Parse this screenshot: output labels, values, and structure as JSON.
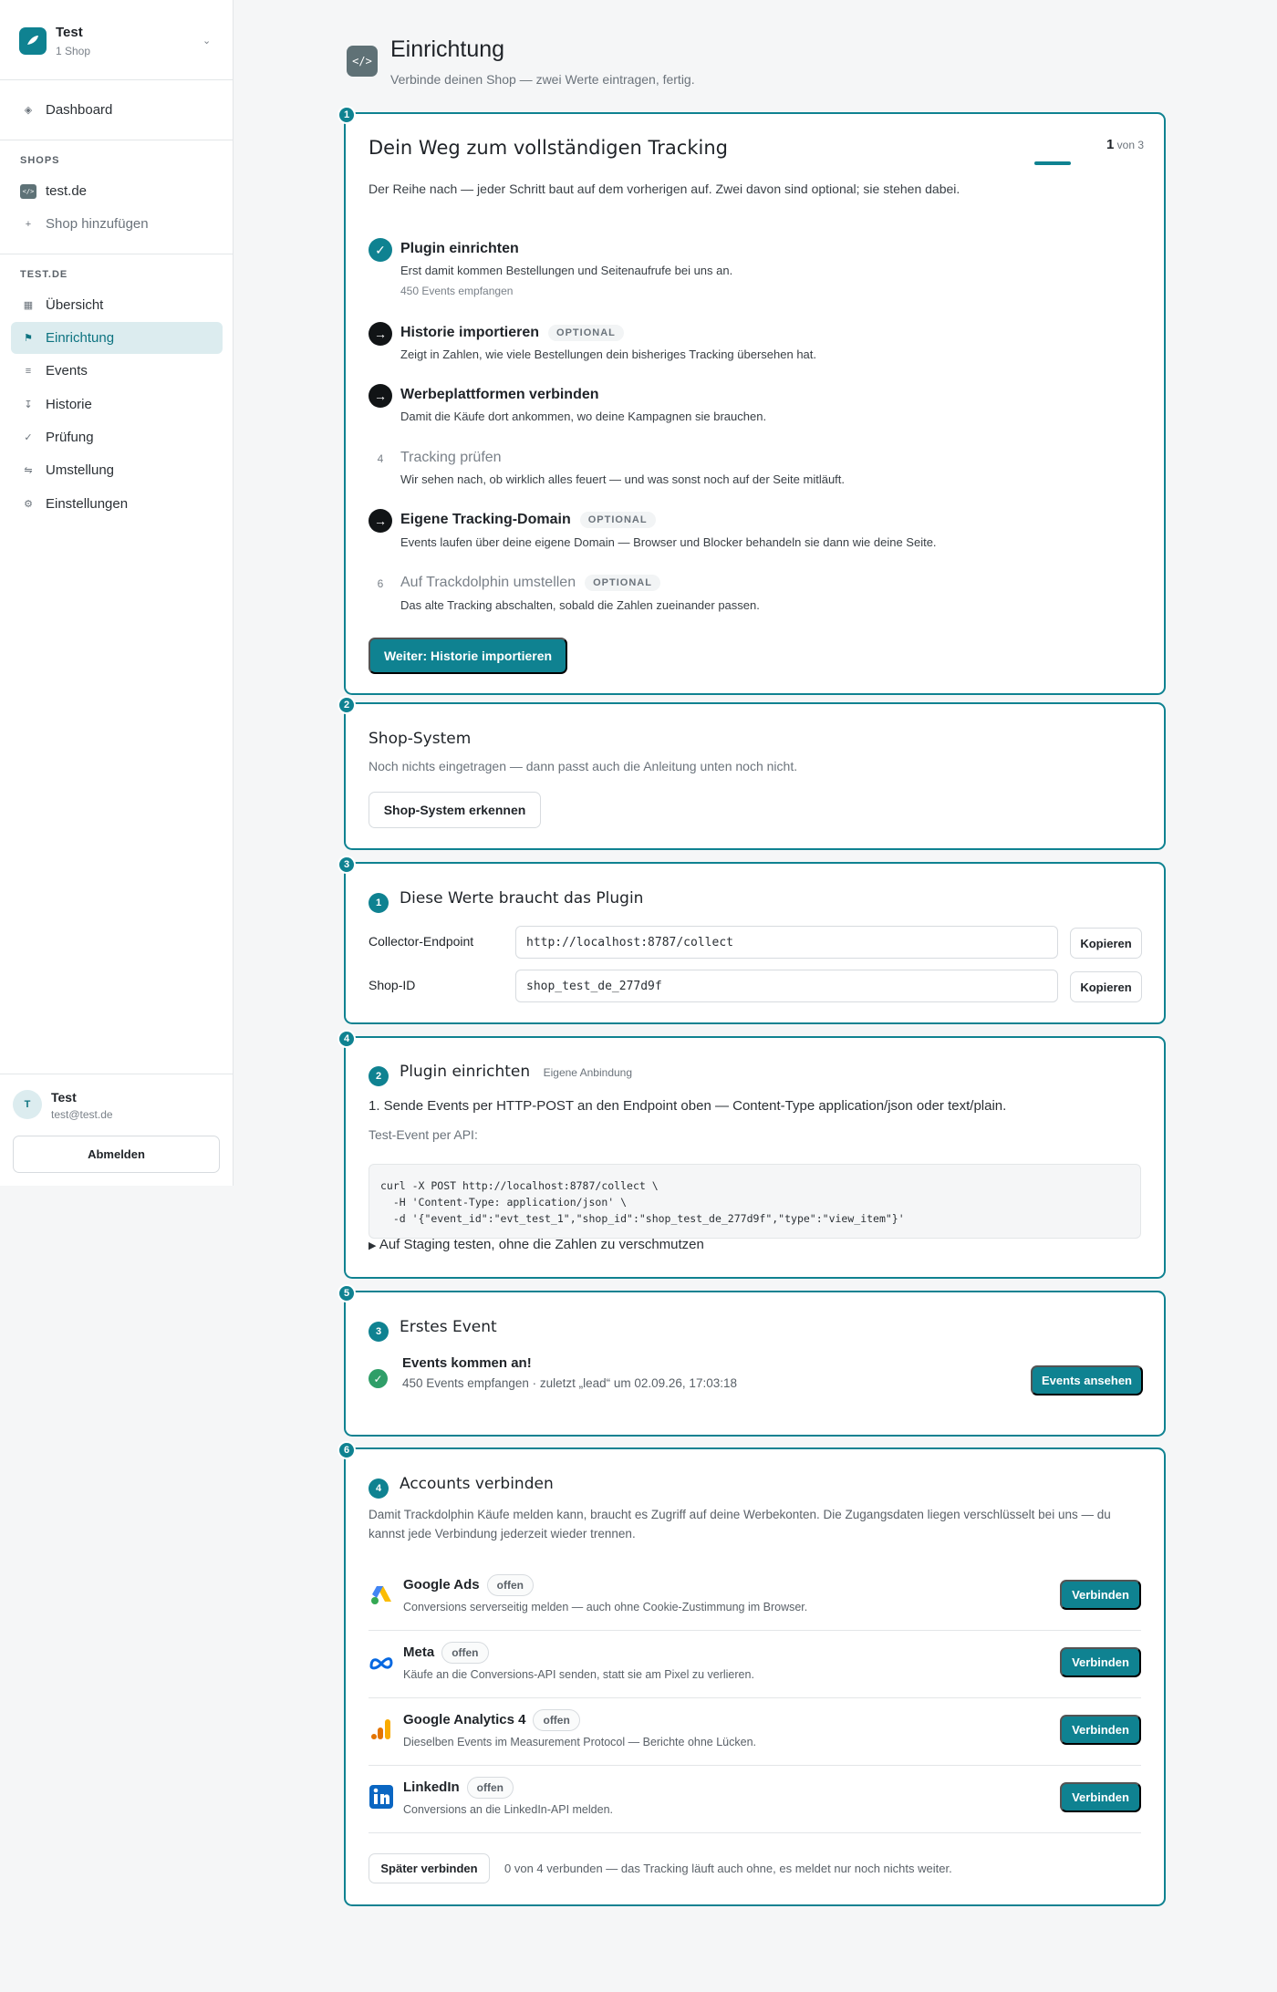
{
  "org": {
    "name": "Test",
    "sub": "1 Shop"
  },
  "nav": {
    "dashboard": "Dashboard",
    "shops_heading": "SHOPS",
    "shop": "test.de",
    "add_shop": "Shop hinzufügen",
    "site_heading": "TEST.DE",
    "items": [
      {
        "label": "Übersicht",
        "icon": "grid-icon"
      },
      {
        "label": "Einrichtung",
        "icon": "flag-icon"
      },
      {
        "label": "Events",
        "icon": "list-icon"
      },
      {
        "label": "Historie",
        "icon": "history-icon"
      },
      {
        "label": "Prüfung",
        "icon": "check-icon"
      },
      {
        "label": "Umstellung",
        "icon": "swap-icon"
      },
      {
        "label": "Einstellungen",
        "icon": "gear-icon"
      }
    ],
    "active": "Einrichtung"
  },
  "user": {
    "initial": "T",
    "name": "Test",
    "email": "test@test.de",
    "logout": "Abmelden"
  },
  "header": {
    "icon": "</>",
    "title": "Einrichtung",
    "subtitle": "Verbinde deinen Shop — zwei Werte eintragen, fertig."
  },
  "roadmap": {
    "badge": "1",
    "title": "Dein Weg zum vollständigen Tracking",
    "counter_current": "1",
    "counter_total": "von 3",
    "progress": 0.333,
    "intro": "Der Reihe nach — jeder Schritt baut auf dem vorherigen auf. Zwei davon sind optional; sie stehen dabei.",
    "steps": [
      {
        "marker": "✓",
        "title": "Plugin einrichten",
        "desc": "Erst damit kommen Bestellungen und Seitenaufrufe bei uns an.",
        "extra": "450 Events empfangen",
        "optional": ""
      },
      {
        "marker": "→",
        "title": "Historie importieren",
        "desc": "Zeigt in Zahlen, wie viele Bestellungen dein bisheriges Tracking übersehen hat.",
        "extra": "",
        "optional": "OPTIONAL"
      },
      {
        "marker": "→",
        "title": "Werbeplattformen verbinden",
        "desc": "Damit die Käufe dort ankommen, wo deine Kampagnen sie brauchen.",
        "extra": "",
        "optional": ""
      },
      {
        "marker": "4",
        "title": "Tracking prüfen",
        "desc": "Wir sehen nach, ob wirklich alles feuert — und was sonst noch auf der Seite mitläuft.",
        "extra": "",
        "optional": ""
      },
      {
        "marker": "→",
        "title": "Eigene Tracking-Domain",
        "desc": "Events laufen über deine eigene Domain — Browser und Blocker behandeln sie dann wie deine Seite.",
        "extra": "",
        "optional": "OPTIONAL"
      },
      {
        "marker": "6",
        "title": "Auf Trackdolphin umstellen",
        "desc": "Das alte Tracking abschalten, sobald die Zahlen zueinander passen.",
        "extra": "",
        "optional": "OPTIONAL"
      }
    ],
    "cta": "Weiter: Historie importieren"
  },
  "shop_system": {
    "badge": "2",
    "title": "Shop-System",
    "desc": "Noch nichts eingetragen — dann passt auch die Anleitung unten noch nicht.",
    "button": "Shop-System erkennen"
  },
  "plugin_values": {
    "badge": "3",
    "step": "1",
    "title": "Diese Werte braucht das Plugin",
    "fields": [
      {
        "label": "Collector-Endpoint",
        "value": "http://localhost:8787/collect",
        "button": "Kopieren"
      },
      {
        "label": "Shop-ID",
        "value": "shop_test_de_277d9f",
        "button": "Kopieren"
      }
    ]
  },
  "plugin_setup": {
    "badge": "4",
    "step": "2",
    "title": "Plugin einrichten",
    "tag": "Eigene Anbindung",
    "instruction": "1. Sende Events per HTTP-POST an den Endpoint oben — Content-Type application/json oder text/plain.",
    "test_label": "Test-Event per API:",
    "code": "curl -X POST http://localhost:8787/collect \\\n  -H 'Content-Type: application/json' \\\n  -d '{\"event_id\":\"evt_test_1\",\"shop_id\":\"shop_test_de_277d9f\",\"type\":\"view_item\"}'",
    "details": "Auf Staging testen, ohne die Zahlen zu verschmutzen"
  },
  "first_event": {
    "badge": "5",
    "step": "3",
    "title": "Erstes Event",
    "status_title": "Events kommen an!",
    "status_desc": "450 Events empfangen · zuletzt „lead“ um 02.09.26, 17:03:18",
    "button": "Events ansehen"
  },
  "accounts": {
    "badge": "6",
    "step": "4",
    "title": "Accounts verbinden",
    "desc": "Damit Trackdolphin Käufe melden kann, braucht es Zugriff auf deine Werbekonten. Die Zugangsdaten liegen verschlüsselt bei uns — du kannst jede Verbindung jederzeit wieder trennen.",
    "items": [
      {
        "name": "Google Ads",
        "status": "offen",
        "desc": "Conversions serverseitig melden — auch ohne Cookie-Zustimmung im Browser.",
        "button": "Verbinden",
        "icon": "google-ads-icon"
      },
      {
        "name": "Meta",
        "status": "offen",
        "desc": "Käufe an die Conversions-API senden, statt sie am Pixel zu verlieren.",
        "button": "Verbinden",
        "icon": "meta-icon"
      },
      {
        "name": "Google Analytics 4",
        "status": "offen",
        "desc": "Dieselben Events im Measurement Protocol — Berichte ohne Lücken.",
        "button": "Verbinden",
        "icon": "google-analytics-icon"
      },
      {
        "name": "LinkedIn",
        "status": "offen",
        "desc": "Conversions an die LinkedIn-API melden.",
        "button": "Verbinden",
        "icon": "linkedin-icon"
      }
    ],
    "later_button": "Später verbinden",
    "footer_note": "0 von 4 verbunden — das Tracking läuft auch ohne, es meldet nur noch nichts weiter.",
    "colors": {
      "teal": "#0f8291",
      "google_blue": "#4285f4",
      "google_yellow": "#fbbc04",
      "google_green": "#34a853",
      "meta_blue": "#0668e1",
      "ga_orange": "#f9ab00",
      "linkedin": "#0a66c2"
    }
  }
}
